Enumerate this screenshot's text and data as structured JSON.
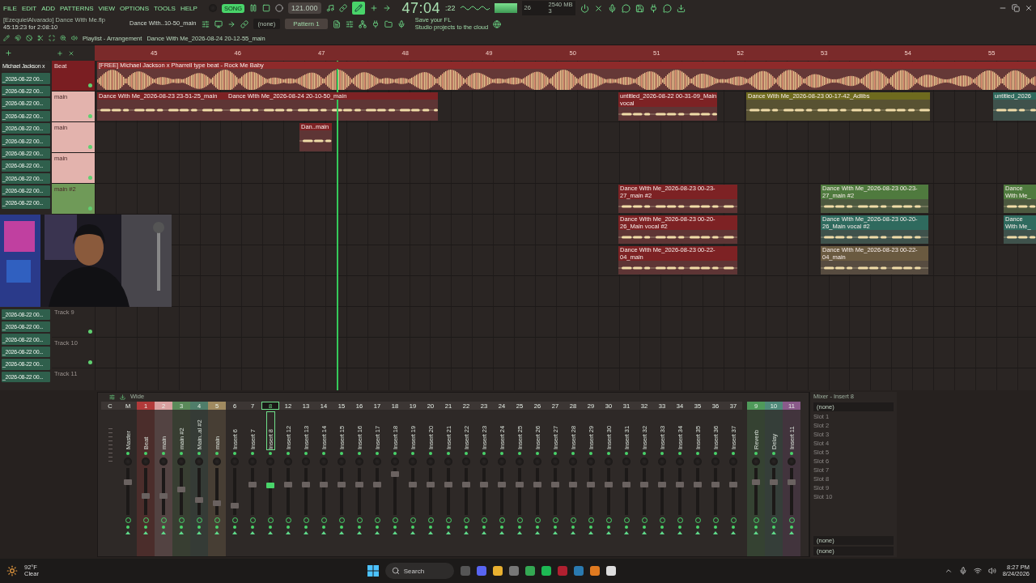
{
  "menu": [
    "FILE",
    "EDIT",
    "ADD",
    "PATTERNS",
    "VIEW",
    "OPTIONS",
    "TOOLS",
    "HELP"
  ],
  "hint": {
    "file": "[EzequielAlvarado] Dance With Me.flp",
    "duration": "45:15:23 for 2:08:10",
    "clip": "Dance With..10-50_main"
  },
  "transport": {
    "mode": "SONG",
    "mode_on": true,
    "tempo": "121.000",
    "time": "47:04",
    "time_small": ":22",
    "cpu": "26",
    "memory": "2540 MB",
    "voices": "3"
  },
  "channel_select": "(none)",
  "pattern": "Pattern 1",
  "cloud_note": [
    "Save your FL",
    "Studio projects to the cloud"
  ],
  "playlist": {
    "title": "Playlist - Arrangement",
    "arrangement": "Dance With Me_2026-08-24 20-12-55_main",
    "ruler": [
      "45",
      "46",
      "47",
      "48",
      "49",
      "50",
      "51",
      "52",
      "53",
      "54",
      "55"
    ],
    "browser_top": [
      "Michael Jackson x",
      "_2026-08-22 00...",
      "_2026-08-22 00...",
      "_2026-08-22 00...",
      "_2026-08-22 00...",
      "_2026-08-22 00...",
      "_2026-08-22 00...",
      "_2026-08-22 00...",
      "_2026-08-22 00...",
      "_2026-08-22 00...",
      "_2026-08-22 00...",
      "_2026-08-22 00..."
    ],
    "browser_bottom": [
      "_2026-08-22 00...",
      "_2026-08-22 00...",
      "_2026-08-22 00...",
      "_2026-08-22 00...",
      "_2026-08-22 00...",
      "_2026-08-22 00..."
    ],
    "tracks": [
      {
        "name": "Beat",
        "color": "#7a1e22",
        "clips": [
          {
            "name": "[FREE] Michael Jackson x Pharrell type beat - Rock Me Baby",
            "color": "#8e2a2a"
          }
        ]
      },
      {
        "name": "main",
        "color": "#e3b3ad",
        "clips": [
          {
            "name": "Dance With Me_2026-08-23 23-51-25_main",
            "color": "#7d2224"
          },
          {
            "name": "Dance With Me_2026-08-24 20-10-50_main",
            "color": "#7d2224"
          },
          {
            "name": "untitled_2026-08-22 00-31-09_Main vocal",
            "color": "#7d2224"
          },
          {
            "name": "Dance With Me_2026-08-23 00-17-42_Adlibs",
            "color": "#6e6a1e"
          },
          {
            "name": "untitled_2026",
            "color": "#2f6a5e"
          }
        ]
      },
      {
        "name": "main",
        "color": "#e3b3ad",
        "clips": [
          {
            "name": "Dan..main",
            "color": "#7d2224"
          }
        ]
      },
      {
        "name": "main",
        "color": "#e3b3ad"
      },
      {
        "name": "main #2",
        "color": "#6f9a58",
        "clips": [
          {
            "name": "Dance With Me_2026-08-23 00-23-27_main #2",
            "color": "#7d2224"
          },
          {
            "name": "Dance With Me_2026-08-23 00-23-27_main #2",
            "color": "#4f7a3e"
          },
          {
            "name": "Dance With Me_",
            "color": "#4f7a3e"
          }
        ]
      },
      {
        "clips": [
          {
            "name": "Dance With Me_2026-08-23 00-20-26_Main vocal #2",
            "color": "#7d2224"
          },
          {
            "name": "Dance With Me_2026-08-23 00-20-26_Main vocal #2",
            "color": "#2f6a5e"
          },
          {
            "name": "Dance With Me_",
            "color": "#2f6a5e"
          }
        ]
      },
      {
        "clips": [
          {
            "name": "Dance With Me_2026-08-23 00-22-04_main",
            "color": "#7d2224"
          },
          {
            "name": "Dance With Me_2026-08-23 00-22-04_main",
            "color": "#6a5a40"
          }
        ]
      }
    ],
    "tracks_below": [
      {
        "name": "Track 9"
      },
      {
        "name": "Track 10"
      },
      {
        "name": "Track 11"
      }
    ]
  },
  "mixer": {
    "mode": "Wide",
    "strips": [
      {
        "number": "C",
        "kind": "current",
        "selected": false
      },
      {
        "number": "M",
        "name": "Master",
        "kind": "master",
        "level": 0.72,
        "selected": false
      },
      {
        "number": "1",
        "name": "Beat",
        "kind": "insert",
        "level": 0.4,
        "color": "#b13a3a",
        "selected": false
      },
      {
        "number": "2",
        "name": "main",
        "kind": "insert",
        "level": 0.4,
        "color": "#d8a0a0",
        "selected": false
      },
      {
        "number": "3",
        "name": "main #2",
        "kind": "insert",
        "level": 0.55,
        "color": "#5a8a5a",
        "selected": false
      },
      {
        "number": "4",
        "name": "Main..al #2",
        "kind": "insert",
        "level": 0.3,
        "color": "#4f7d6a",
        "selected": false
      },
      {
        "number": "5",
        "name": "main",
        "kind": "insert",
        "level": 0.22,
        "color": "#a08a60",
        "selected": false
      },
      {
        "number": "6",
        "name": "Insert 6",
        "kind": "insert",
        "level": 0.15,
        "selected": false
      },
      {
        "number": "7",
        "name": "Insert 7",
        "kind": "insert",
        "level": 0.67,
        "selected": false
      },
      {
        "number": "8",
        "name": "Insert 8",
        "kind": "insert",
        "level": 0.65,
        "selected": true
      },
      {
        "number": "12",
        "name": "Insert 12",
        "kind": "insert",
        "level": 0.67,
        "selected": false
      },
      {
        "number": "13",
        "name": "Insert 13",
        "kind": "insert",
        "level": 0.67,
        "selected": false
      },
      {
        "number": "14",
        "name": "Insert 14",
        "kind": "insert",
        "level": 0.67,
        "selected": false
      },
      {
        "number": "15",
        "name": "Insert 15",
        "kind": "insert",
        "level": 0.67,
        "selected": false
      },
      {
        "number": "16",
        "name": "Insert 16",
        "kind": "insert",
        "level": 0.67,
        "selected": false
      },
      {
        "number": "17",
        "name": "Insert 17",
        "kind": "insert",
        "level": 0.67,
        "selected": false
      },
      {
        "number": "18",
        "name": "Insert 18",
        "kind": "insert",
        "level": 0.93,
        "selected": false
      },
      {
        "number": "19",
        "name": "Insert 19",
        "kind": "insert",
        "level": 0.67,
        "selected": false
      },
      {
        "number": "20",
        "name": "Insert 20",
        "kind": "insert",
        "level": 0.67,
        "selected": false
      },
      {
        "number": "21",
        "name": "Insert 21",
        "kind": "insert",
        "level": 0.67,
        "selected": false
      },
      {
        "number": "22",
        "name": "Insert 22",
        "kind": "insert",
        "level": 0.67,
        "selected": false
      },
      {
        "number": "23",
        "name": "Insert 23",
        "kind": "insert",
        "level": 0.67,
        "selected": false
      },
      {
        "number": "24",
        "name": "Insert 24",
        "kind": "insert",
        "level": 0.67,
        "selected": false
      },
      {
        "number": "25",
        "name": "Insert 25",
        "kind": "insert",
        "level": 0.67,
        "selected": false
      },
      {
        "number": "26",
        "name": "Insert 26",
        "kind": "insert",
        "level": 0.67,
        "selected": false
      },
      {
        "number": "27",
        "name": "Insert 27",
        "kind": "insert",
        "level": 0.67,
        "selected": false
      },
      {
        "number": "28",
        "name": "Insert 28",
        "kind": "insert",
        "level": 0.67,
        "selected": false
      },
      {
        "number": "29",
        "name": "Insert 29",
        "kind": "insert",
        "level": 0.67,
        "selected": false
      },
      {
        "number": "30",
        "name": "Insert 30",
        "kind": "insert",
        "level": 0.67,
        "selected": false
      },
      {
        "number": "31",
        "name": "Insert 31",
        "kind": "insert",
        "level": 0.67,
        "selected": false
      },
      {
        "number": "32",
        "name": "Insert 32",
        "kind": "insert",
        "level": 0.67,
        "selected": false
      },
      {
        "number": "33",
        "name": "Insert 33",
        "kind": "insert",
        "level": 0.67,
        "selected": false
      },
      {
        "number": "34",
        "name": "Insert 34",
        "kind": "insert",
        "level": 0.67,
        "selected": false
      },
      {
        "number": "35",
        "name": "Insert 35",
        "kind": "insert",
        "level": 0.67,
        "selected": false
      },
      {
        "number": "36",
        "name": "Insert 36",
        "kind": "insert",
        "level": 0.67,
        "selected": false
      },
      {
        "number": "37",
        "name": "Insert 37",
        "kind": "insert",
        "level": 0.67,
        "selected": false
      }
    ],
    "sends": [
      {
        "number": "9",
        "name": "Reverb",
        "kind": "insert",
        "level": 0.72,
        "color": "#4f9a5a",
        "selected": false
      },
      {
        "number": "10",
        "name": "Delay",
        "kind": "insert",
        "level": 0.72,
        "color": "#4f8a7a",
        "selected": false
      },
      {
        "number": "11",
        "name": "Insert 11",
        "kind": "insert",
        "level": 0.72,
        "color": "#8a5a8a",
        "selected": false
      }
    ],
    "panel": {
      "title": "Mixer - Insert 8",
      "input": "(none)",
      "slots": [
        "Slot 1",
        "Slot 2",
        "Slot 3",
        "Slot 4",
        "Slot 5",
        "Slot 6",
        "Slot 7",
        "Slot 8",
        "Slot 9",
        "Slot 10"
      ],
      "output_a": "(none)",
      "output_b": "(none)"
    }
  },
  "taskbar": {
    "temperature": "92°F",
    "weather": "Clear",
    "search": "Search",
    "time": "8:27 PM",
    "date": "8/24/2026"
  }
}
